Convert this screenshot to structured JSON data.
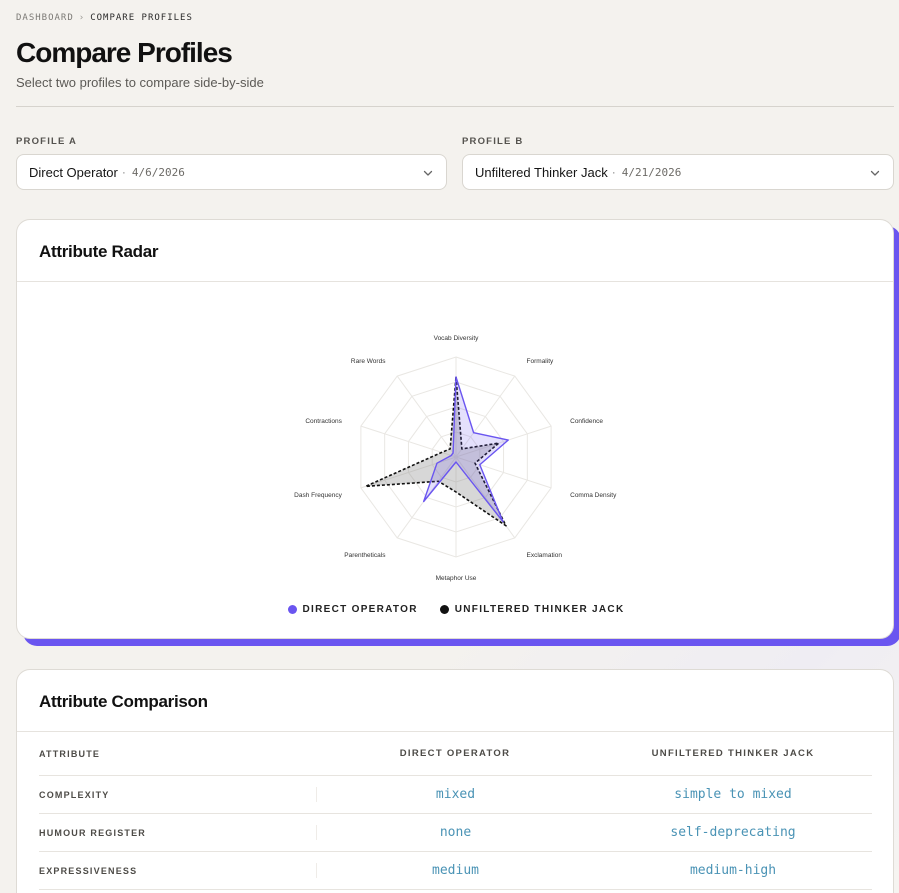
{
  "breadcrumb": {
    "root": "DASHBOARD",
    "separator": "›",
    "current": "COMPARE PROFILES"
  },
  "header": {
    "title": "Compare Profiles",
    "subtitle": "Select two profiles to compare side-by-side"
  },
  "profile_a": {
    "label": "PROFILE A",
    "name": "Direct Operator",
    "dot": "·",
    "date": "4/6/2026"
  },
  "profile_b": {
    "label": "PROFILE B",
    "name": "Unfiltered Thinker Jack",
    "dot": "·",
    "date": "4/21/2026"
  },
  "radar": {
    "title": "Attribute Radar",
    "legend": [
      {
        "label": "DIRECT OPERATOR",
        "color": "#6a55f0"
      },
      {
        "label": "UNFILTERED THINKER JACK",
        "color": "#111111"
      }
    ]
  },
  "chart_data": {
    "type": "radar",
    "axes": [
      "Vocab Diversity",
      "Formality",
      "Confidence",
      "Comma Density",
      "Exclamation",
      "Metaphor Use",
      "Parentheticals",
      "Dash Frequency",
      "Contractions",
      "Rare Words"
    ],
    "rlim": [
      0,
      1
    ],
    "grid_levels": 4,
    "series": [
      {
        "name": "Direct Operator",
        "color": "#6a55f0",
        "fill": "rgba(106,85,240,0.18)",
        "values": [
          0.8,
          0.3,
          0.55,
          0.25,
          0.8,
          0.05,
          0.55,
          0.2,
          0.05,
          0.05
        ]
      },
      {
        "name": "Unfiltered Thinker Jack",
        "color": "#111111",
        "fill": "rgba(140,140,140,0.35)",
        "values": [
          0.8,
          0.1,
          0.45,
          0.2,
          0.85,
          0.35,
          0.3,
          0.95,
          0.15,
          0.1
        ]
      }
    ]
  },
  "comparison": {
    "title": "Attribute Comparison",
    "columns": [
      "ATTRIBUTE",
      "DIRECT OPERATOR",
      "UNFILTERED THINKER JACK"
    ],
    "rows": [
      {
        "attribute": "COMPLEXITY",
        "a": "mixed",
        "b": "simple to mixed"
      },
      {
        "attribute": "HUMOUR REGISTER",
        "a": "none",
        "b": "self-deprecating"
      },
      {
        "attribute": "EXPRESSIVENESS",
        "a": "medium",
        "b": "medium-high"
      }
    ]
  }
}
